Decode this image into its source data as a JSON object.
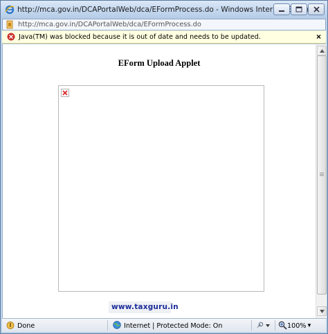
{
  "window": {
    "title": "http://mca.gov.in/DCAPortalWeb/dca/EFormProcess.do - Windows Internet Explorer",
    "address": "http://mca.gov.in/DCAPortalWeb/dca/EFormProcess.do"
  },
  "infobar": {
    "message": "Java(TM) was blocked because it is out of date and needs to be updated.",
    "close_label": "×"
  },
  "page": {
    "heading": "EForm Upload Applet",
    "watermark": "www.taxguru.in"
  },
  "status": {
    "done": "Done",
    "zone": "Internet | Protected Mode: On",
    "zoom": "100%"
  },
  "colors": {
    "frame": "#bcd3ea",
    "infobar_bg": "#ffffe1",
    "watermark_text": "#1b2c9a"
  }
}
